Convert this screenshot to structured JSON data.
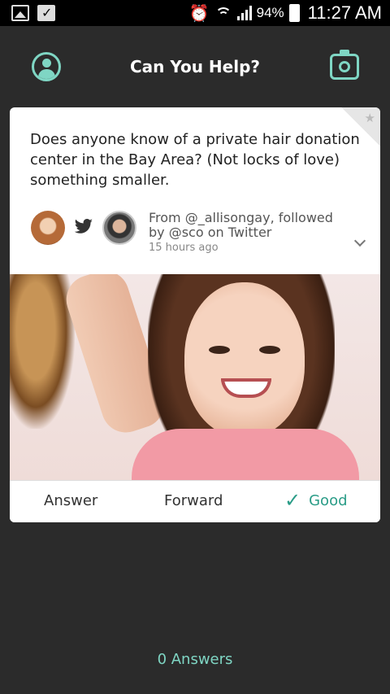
{
  "status_bar": {
    "battery_pct": "94%",
    "time": "11:27 AM",
    "icons": [
      "gallery-icon",
      "bag-check-icon",
      "alarm-icon",
      "wifi-icon",
      "signal-icon",
      "battery-icon"
    ]
  },
  "header": {
    "title": "Can You Help?",
    "left_icon": "profile-icon",
    "right_icon": "camera-icon"
  },
  "card": {
    "question": "Does anyone know of a private hair donation center in the Bay Area? (Not locks of love) something smaller.",
    "from": "From @_allisongay, followed by @sco on Twitter",
    "time_ago": "15 hours ago",
    "actions": {
      "answer": "Answer",
      "forward": "Forward",
      "good": "Good"
    }
  },
  "footer": {
    "answers": "0 Answers"
  },
  "colors": {
    "background": "#2b2b2b",
    "accent": "#7fd6c4",
    "good": "#2a9c87"
  }
}
